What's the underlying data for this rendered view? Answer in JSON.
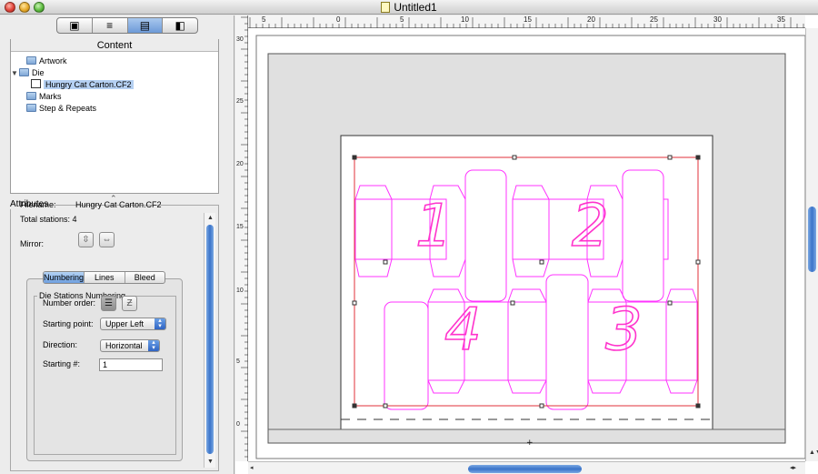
{
  "window": {
    "title": "Untitled1"
  },
  "left_panel": {
    "tabs": [
      {
        "icon": "artwork-tab-icon"
      },
      {
        "icon": "marks-tab-icon"
      },
      {
        "icon": "die-tab-icon",
        "active": true
      },
      {
        "icon": "step-repeat-tab-icon"
      }
    ],
    "content": {
      "label": "Content",
      "tree": [
        {
          "label": "Artwork",
          "icon": "folder-icon",
          "level": 0
        },
        {
          "label": "Die",
          "icon": "folder-icon",
          "level": 0,
          "expanded": true
        },
        {
          "label": "Hungry Cat Carton.CF2",
          "icon": "die-file-icon",
          "level": 1,
          "selected": true
        },
        {
          "label": "Marks",
          "icon": "folder-icon",
          "level": 0
        },
        {
          "label": "Step & Repeats",
          "icon": "folder-icon",
          "level": 0
        }
      ]
    },
    "attributes": {
      "label": "Attributes",
      "filename_label": "Filename:",
      "filename_value": "Hungry Cat Carton.CF2",
      "total_stations": "Total stations: 4",
      "mirror_label": "Mirror:",
      "tabs": [
        "Numbering",
        "Lines",
        "Bleed"
      ],
      "active_tab": "Numbering",
      "die_stations": {
        "label": "Die Stations Numbering",
        "number_order_label": "Number order:",
        "starting_point_label": "Starting point:",
        "starting_point_value": "Upper Left",
        "direction_label": "Direction:",
        "direction_value": "Horizontal",
        "starting_num_label": "Starting #:",
        "starting_num_value": "1"
      }
    }
  },
  "document": {
    "hruler_labels": [
      "5",
      "0",
      "5",
      "10",
      "15",
      "20",
      "25",
      "30",
      "35"
    ],
    "vruler_labels": [
      "30",
      "25",
      "20",
      "15",
      "10",
      "5",
      "0"
    ],
    "station_numbers": [
      "1",
      "2",
      "4",
      "3"
    ],
    "colors": {
      "die_lines": "#ff33ff",
      "bounding_box": "#e0303a",
      "station_number": "#ff33cc",
      "pasteboard": "#e0e0e0"
    }
  }
}
